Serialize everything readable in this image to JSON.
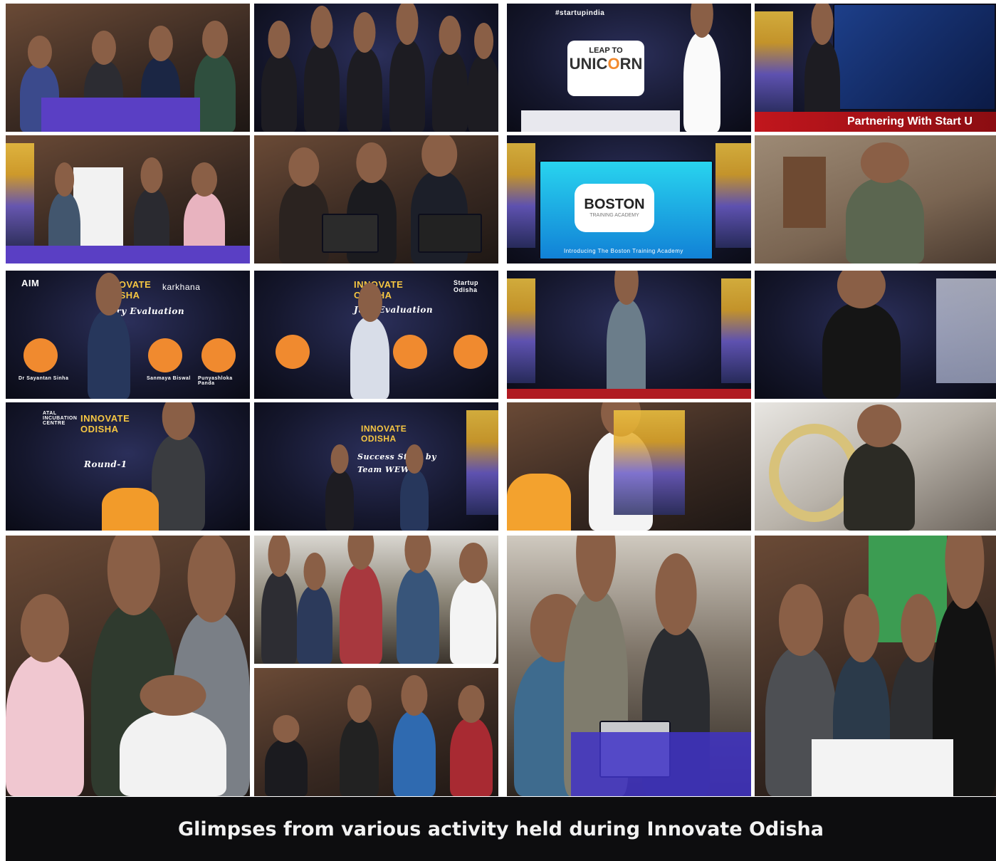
{
  "caption": "Glimpses from various activity held during Innovate Odisha",
  "tiles": {
    "leap_line1": "LEAP TO",
    "leap_line2": "UNIC",
    "leap_line2b": "RN",
    "partnering": "Partnering With Start U",
    "boston_title": "BOSTON",
    "boston_sub": "TRAINING ACADEMY",
    "boston_intro": "Introducing The Boston Training Academy",
    "innovate": "INNOVATE ODISHA",
    "aic": "ATAL INCUBATION CENTRE",
    "karkhana": "karkhana",
    "startup_odisha": "Startup Odisha",
    "aim": "AIM",
    "jury_eval": "Jury Evaluation",
    "round1": "Round-1",
    "success_story": "Success Story by",
    "team": "Team WEWE",
    "speaker1": "Dr Sayantan Sinha",
    "speaker2": "Sanmaya Biswal",
    "speaker3": "Punyashloka Panda",
    "hashtag": "#startupindia"
  }
}
